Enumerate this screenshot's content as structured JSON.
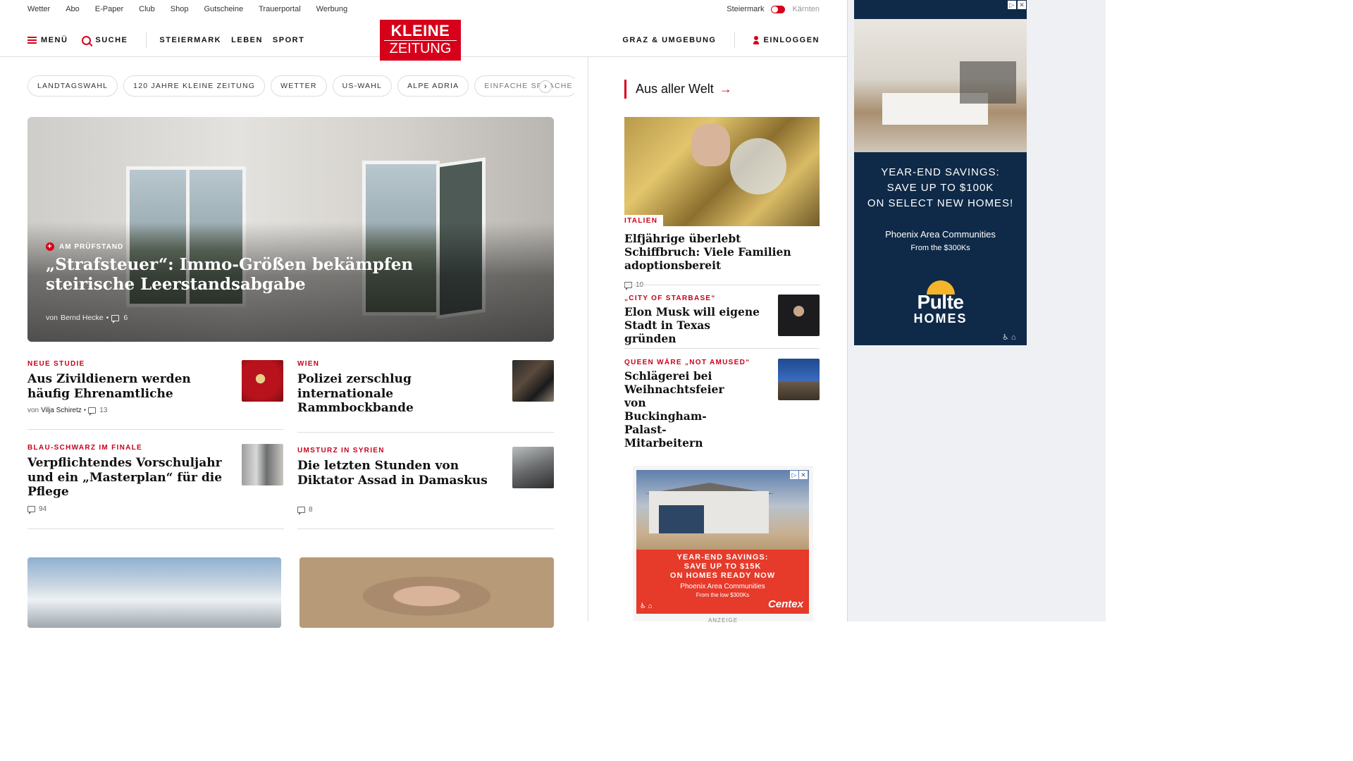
{
  "util_links": [
    "Wetter",
    "Abo",
    "E-Paper",
    "Club",
    "Shop",
    "Gutscheine",
    "Trauerportal",
    "Werbung"
  ],
  "region": {
    "active": "Steiermark",
    "inactive": "Kärnten"
  },
  "nav": {
    "menu": "MENÜ",
    "search": "SUCHE",
    "sections": [
      "STEIERMARK",
      "LEBEN",
      "SPORT"
    ],
    "right_link": "GRAZ & UMGEBUNG",
    "login": "EINLOGGEN"
  },
  "logo": {
    "line1": "KLEINE",
    "line2": "ZEITUNG"
  },
  "chips": [
    "LANDTAGSWAHL",
    "120 JAHRE KLEINE ZEITUNG",
    "WETTER",
    "US-WAHL",
    "ALPE ADRIA",
    "EINFACHE SPRACHE"
  ],
  "chip_next": "›",
  "hero": {
    "kicker": "AM PRÜFSTAND",
    "title": "„Strafsteuer“: Immo-Größen bekämpfen steirische Leerstandsabgabe",
    "author_prefix": "von",
    "author": "Bernd Hecke",
    "comments": "6"
  },
  "articles": [
    {
      "kicker": "NEUE STUDIE",
      "title": "Aus Zivildienern werden häufig Ehrenamtliche",
      "author_prefix": "von",
      "author": "Vilja Schiretz",
      "comments": "13"
    },
    {
      "kicker": "WIEN",
      "title": "Polizei zerschlug internationale Rammbockbande",
      "comments": ""
    },
    {
      "kicker": "BLAU-SCHWARZ IM FINALE",
      "title": "Verpflichtendes Vorschuljahr und ein „Masterplan“ für die Pflege",
      "comments": "94"
    },
    {
      "kicker": "UMSTURZ IN SYRIEN",
      "title": "Die letzten Stunden von Diktator Assad in Damaskus",
      "comments": "8"
    }
  ],
  "side": {
    "section_title": "Aus aller Welt",
    "arrow": "→",
    "featured": {
      "kicker": "ITALIEN",
      "title": "Elfjährige überlebt Schiffbruch: Viele Familien adoptionsbereit",
      "comments": "10"
    },
    "items": [
      {
        "kicker": "„CITY OF STARBASE“",
        "title": "Elon Musk will eigene Stadt in Texas gründen"
      },
      {
        "kicker": "QUEEN WÄRE „NOT AMUSED“",
        "title": "Schlägerei bei Weihnachtsfeier von Buckingham-Palast-Mitarbeitern"
      }
    ]
  },
  "ad1": {
    "headline": [
      "YEAR-END SAVINGS:",
      "SAVE UP TO $100K",
      "ON SELECT NEW HOMES!"
    ],
    "sub1": "Phoenix Area Communities",
    "sub2": "From the $300Ks",
    "brand1": "Pulte",
    "brand2": "HOMES"
  },
  "ad2": {
    "headline": [
      "YEAR-END SAVINGS:",
      "SAVE UP TO $15K",
      "ON HOMES READY NOW"
    ],
    "sub1": "Phoenix Area Communities",
    "sub2": "From the low $300Ks",
    "brand": "Centex",
    "label": "ANZEIGE"
  },
  "colors": {
    "brand_red": "#d7001a",
    "kicker_red": "#c8001a",
    "ad1_bg": "#0f2a48",
    "ad2_bg": "#e63a2a"
  }
}
